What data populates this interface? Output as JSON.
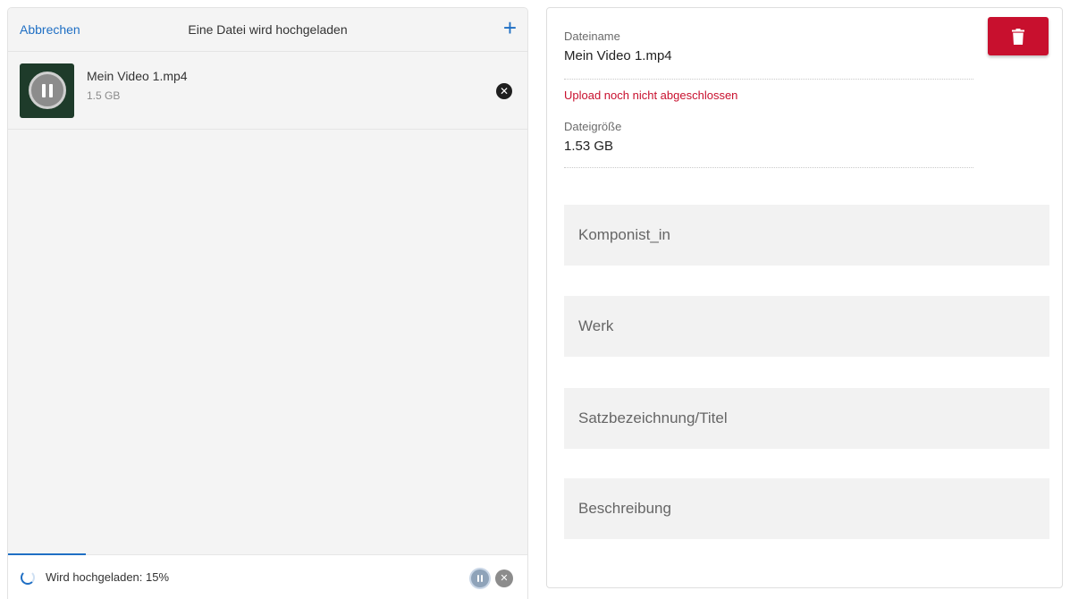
{
  "uploader": {
    "header": {
      "cancel_label": "Abbrechen",
      "title": "Eine Datei wird hochgeladen",
      "add_symbol": "+"
    },
    "files": [
      {
        "name": "Mein Video 1.mp4",
        "size": "1.5 GB",
        "thumb_icon": "pause-icon",
        "remove_icon": "close-icon"
      }
    ],
    "footer": {
      "status_text": "Wird hochgeladen: 15%",
      "progress_percent": 15,
      "pause_icon": "pause-icon",
      "cancel_icon": "close-icon"
    }
  },
  "details": {
    "filename_label": "Dateiname",
    "filename_value": "Mein Video 1.mp4",
    "error_text": "Upload noch nicht abgeschlossen",
    "filesize_label": "Dateigröße",
    "filesize_value": "1.53 GB",
    "delete_icon": "trash-icon",
    "fields": [
      {
        "placeholder": "Komponist_in"
      },
      {
        "placeholder": "Werk"
      },
      {
        "placeholder": "Satzbezeichnung/Titel"
      },
      {
        "placeholder": "Beschreibung"
      }
    ]
  },
  "colors": {
    "accent": "#1f6fc4",
    "danger": "#c8102e",
    "panel_bg": "#f4f4f4",
    "input_bg": "#f2f2f2"
  }
}
